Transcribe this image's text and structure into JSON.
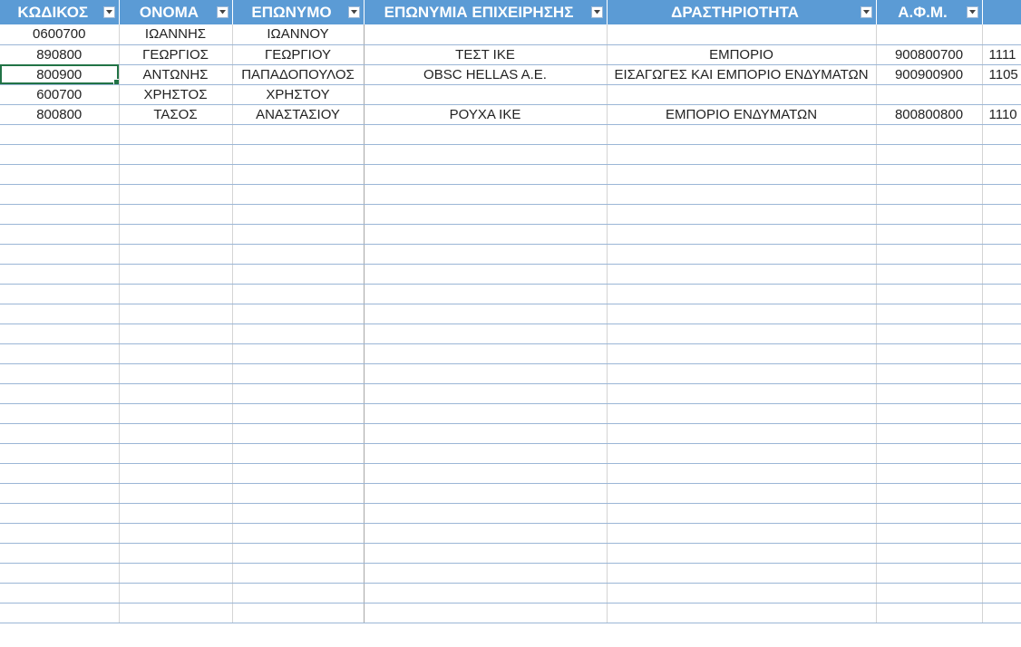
{
  "columns": [
    {
      "label": "ΚΩΔΙΚΟΣ",
      "filter": true
    },
    {
      "label": "ΟΝΟΜΑ",
      "filter": true
    },
    {
      "label": "ΕΠΩΝΥΜΟ",
      "filter": true
    },
    {
      "label": "ΕΠΩΝΥΜΙΑ ΕΠΙΧΕΙΡΗΣΗΣ",
      "filter": true
    },
    {
      "label": "ΔΡΑΣΤΗΡΙΟΤΗΤΑ",
      "filter": true
    },
    {
      "label": "Α.Φ.Μ.",
      "filter": true
    },
    {
      "label": "",
      "filter": false
    }
  ],
  "rows": [
    [
      "0600700",
      "ΙΩΑΝΝΗΣ",
      "ΙΩΑΝΝΟΥ",
      "",
      "",
      "",
      ""
    ],
    [
      "890800",
      "ΓΕΩΡΓΙΟΣ",
      "ΓΕΩΡΓΙΟΥ",
      "ΤΕΣΤ ΙΚΕ",
      "ΕΜΠΟΡΙΟ",
      "900800700",
      "1111"
    ],
    [
      "800900",
      "ΑΝΤΩΝΗΣ",
      "ΠΑΠΑΔΟΠΟΥΛΟΣ",
      "OBSC HELLAS A.E.",
      "ΕΙΣΑΓΩΓΕΣ ΚΑΙ ΕΜΠΟΡΙΟ ΕΝΔΥΜΑΤΩΝ",
      "900900900",
      "1105"
    ],
    [
      "600700",
      "ΧΡΗΣΤΟΣ",
      "ΧΡΗΣΤΟΥ",
      "",
      "",
      "",
      ""
    ],
    [
      "800800",
      "ΤΑΣΟΣ",
      "ΑΝΑΣΤΑΣΙΟΥ",
      "ΡΟΥΧΑ ΙΚΕ",
      "ΕΜΠΟΡΙΟ ΕΝΔΥΜΑΤΩΝ",
      "800800800",
      "1110"
    ]
  ],
  "empty_rows": 25,
  "active_cell": {
    "row": 2,
    "col": 0
  },
  "colors": {
    "header_bg": "#5b9bd5",
    "header_text": "#ffffff",
    "row_border": "#9bb6d6",
    "active_cell_border": "#217346"
  },
  "icons": {
    "filter": "filter-dropdown-icon"
  }
}
